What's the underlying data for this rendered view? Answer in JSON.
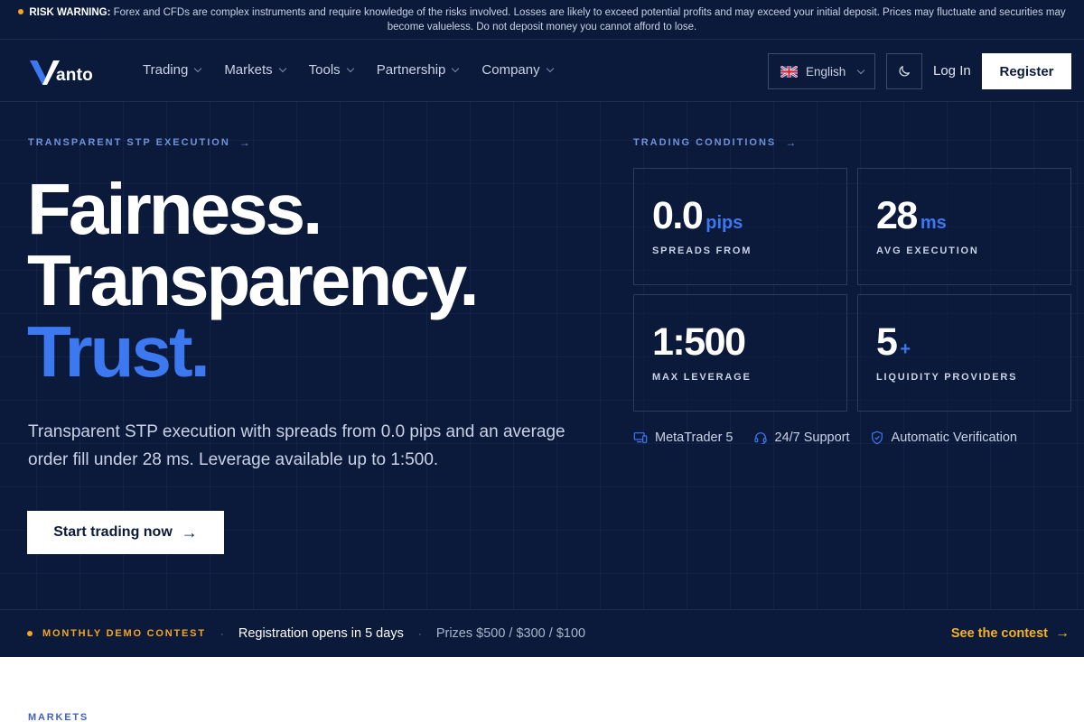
{
  "risk_banner": {
    "label": "RISK WARNING:",
    "text": "Forex and CFDs are complex instruments and require knowledge of the risks involved. Losses are likely to exceed potential profits and may exceed your initial deposit. Prices may fluctuate and securities may become valueless. Do not deposit money you cannot afford to lose."
  },
  "header": {
    "logo_text": "anto",
    "menu": [
      {
        "label": "Trading"
      },
      {
        "label": "Markets"
      },
      {
        "label": "Tools"
      },
      {
        "label": "Partnership"
      },
      {
        "label": "Company"
      }
    ],
    "language": "English",
    "login": "Log In",
    "register": "Register"
  },
  "hero": {
    "eyebrow": "TRANSPARENT STP EXECUTION",
    "headline": [
      "Fairness.",
      "Transparency.",
      "Trust."
    ],
    "subtitle": "Transparent STP execution with spreads from 0.0 pips and an average order fill under 28 ms. Leverage available up to 1:500.",
    "cta": "Start trading now"
  },
  "conditions": {
    "eyebrow": "TRADING CONDITIONS",
    "stats": [
      {
        "value": "0.0",
        "unit": "pips",
        "label": "SPREADS FROM"
      },
      {
        "value": "28",
        "unit": "ms",
        "label": "AVG EXECUTION"
      },
      {
        "value": "1:500",
        "unit": "",
        "label": "MAX LEVERAGE"
      },
      {
        "value": "5",
        "unit": "+",
        "label": "LIQUIDITY PROVIDERS"
      }
    ],
    "features": [
      {
        "label": "MetaTrader 5",
        "icon": "monitor-icon"
      },
      {
        "label": "24/7 Support",
        "icon": "headset-icon"
      },
      {
        "label": "Automatic Verification",
        "icon": "shield-check-icon"
      }
    ]
  },
  "contest": {
    "tag": "MONTHLY DEMO CONTEST",
    "registration": "Registration opens in 5 days",
    "prizes": "Prizes $500 / $300 / $100",
    "link": "See the contest"
  },
  "markets": {
    "label": "MARKETS"
  },
  "colors": {
    "background": "#0b1a3b",
    "accent": "#3c78f0",
    "highlight": "#f5a623"
  }
}
